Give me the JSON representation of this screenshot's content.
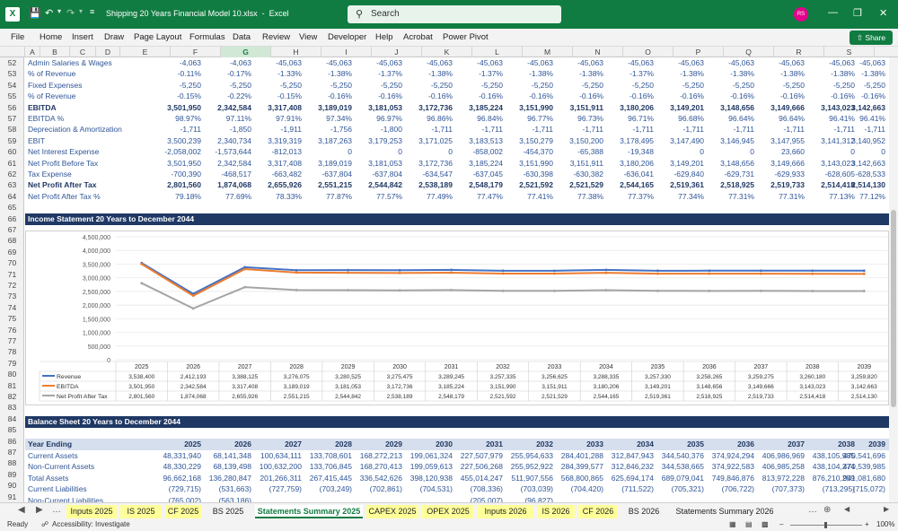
{
  "app": {
    "file_title": "Shipping 20 Years Financial Model 10.xlsx",
    "app_name": "Excel",
    "search_placeholder": "Search",
    "avatar_initials": "RS",
    "share_label": "Share"
  },
  "menu": [
    "File",
    "Home",
    "Insert",
    "Draw",
    "Page Layout",
    "Formulas",
    "Data",
    "Review",
    "View",
    "Developer",
    "Help",
    "Acrobat",
    "Power Pivot"
  ],
  "columns": [
    "A",
    "B",
    "C",
    "D",
    "E",
    "F",
    "G",
    "H",
    "I",
    "J",
    "K",
    "L",
    "M",
    "N",
    "O",
    "P",
    "Q",
    "R",
    "S"
  ],
  "selected_column": "G",
  "row_numbers": [
    "52",
    "53",
    "54",
    "55",
    "56",
    "57",
    "58",
    "59",
    "60",
    "61",
    "62",
    "63",
    "64",
    "65",
    "66",
    "67",
    "68",
    "69",
    "70",
    "71",
    "72",
    "73",
    "74",
    "75",
    "76",
    "77",
    "78",
    "79",
    "80",
    "81",
    "82",
    "83",
    "84",
    "85",
    "86",
    "87",
    "88",
    "89",
    "90",
    "91"
  ],
  "rows": [
    {
      "label": "Admin Salaries & Wages",
      "bold": false,
      "values": [
        "-4,063",
        "-4,063",
        "-45,063",
        "-45,063",
        "-45,063",
        "-45,063",
        "-45,063",
        "-45,063",
        "-45,063",
        "-45,063",
        "-45,063",
        "-45,063",
        "-45,063",
        "-45,063",
        "-45,063"
      ]
    },
    {
      "label": "% of Revenue",
      "bold": false,
      "values": [
        "-0.11%",
        "-0.17%",
        "-1.33%",
        "-1.38%",
        "-1.37%",
        "-1.38%",
        "-1.37%",
        "-1.38%",
        "-1.38%",
        "-1.37%",
        "-1.38%",
        "-1.38%",
        "-1.38%",
        "-1.38%",
        "-1.38%"
      ]
    },
    {
      "label": "Fixed Expenses",
      "bold": false,
      "values": [
        "-5,250",
        "-5,250",
        "-5,250",
        "-5,250",
        "-5,250",
        "-5,250",
        "-5,250",
        "-5,250",
        "-5,250",
        "-5,250",
        "-5,250",
        "-5,250",
        "-5,250",
        "-5,250",
        "-5,250"
      ]
    },
    {
      "label": "% of Revenue",
      "bold": false,
      "values": [
        "-0.15%",
        "-0.22%",
        "-0.15%",
        "-0.16%",
        "-0.16%",
        "-0.16%",
        "-0.16%",
        "-0.16%",
        "-0.16%",
        "-0.16%",
        "-0.16%",
        "-0.16%",
        "-0.16%",
        "-0.16%",
        "-0.16%"
      ]
    },
    {
      "label": "EBITDA",
      "bold": true,
      "values": [
        "3,501,950",
        "2,342,584",
        "3,317,408",
        "3,189,019",
        "3,181,053",
        "3,172,736",
        "3,185,224",
        "3,151,990",
        "3,151,911",
        "3,180,206",
        "3,149,201",
        "3,148,656",
        "3,149,666",
        "3,143,023",
        "3,142,663"
      ]
    },
    {
      "label": "EBITDA %",
      "bold": false,
      "values": [
        "98.97%",
        "97.11%",
        "97.91%",
        "97.34%",
        "96.97%",
        "96.86%",
        "96.84%",
        "96.77%",
        "96.73%",
        "96.71%",
        "96.68%",
        "96.64%",
        "96.64%",
        "96.41%",
        "96.41%"
      ]
    },
    {
      "label": "Depreciation & Amortization",
      "bold": false,
      "values": [
        "-1,711",
        "-1,850",
        "-1,911",
        "-1,756",
        "-1,800",
        "-1,711",
        "-1,711",
        "-1,711",
        "-1,711",
        "-1,711",
        "-1,711",
        "-1,711",
        "-1,711",
        "-1,711",
        "-1,711"
      ]
    },
    {
      "label": "EBIT",
      "bold": false,
      "values": [
        "3,500,239",
        "2,340,734",
        "3,319,319",
        "3,187,263",
        "3,179,253",
        "3,171,025",
        "3,183,513",
        "3,150,279",
        "3,150,200",
        "3,178,495",
        "3,147,490",
        "3,146,945",
        "3,147,955",
        "3,141,312",
        "3,140,952"
      ]
    },
    {
      "label": "Net Interest Expense",
      "bold": false,
      "values": [
        "-2,058,002",
        "-1,573,644",
        "-812,013",
        "0",
        "0",
        "0",
        "-858,002",
        "-454,370",
        "-65,388",
        "-19,348",
        "0",
        "0",
        "23,660",
        "0",
        "0"
      ]
    },
    {
      "label": "Net Profit Before Tax",
      "bold": false,
      "values": [
        "3,501,950",
        "2,342,584",
        "3,317,408",
        "3,189,019",
        "3,181,053",
        "3,172,736",
        "3,185,224",
        "3,151,990",
        "3,151,911",
        "3,180,206",
        "3,149,201",
        "3,148,656",
        "3,149,666",
        "3,143,023",
        "3,142,663"
      ]
    },
    {
      "label": "Tax Expense",
      "bold": false,
      "values": [
        "-700,390",
        "-468,517",
        "-663,482",
        "-637,804",
        "-637,804",
        "-634,547",
        "-637,045",
        "-630,398",
        "-630,382",
        "-636,041",
        "-629,840",
        "-629,731",
        "-629,933",
        "-628,605",
        "-628,533"
      ]
    },
    {
      "label": "Net Profit After Tax",
      "bold": true,
      "values": [
        "2,801,560",
        "1,874,068",
        "2,655,926",
        "2,551,215",
        "2,544,842",
        "2,538,189",
        "2,548,179",
        "2,521,592",
        "2,521,529",
        "2,544,165",
        "2,519,361",
        "2,518,925",
        "2,519,733",
        "2,514,418",
        "2,514,130"
      ]
    },
    {
      "label": "Net Profit After Tax %",
      "bold": false,
      "values": [
        "79.18%",
        "77.69%",
        "78.33%",
        "77.87%",
        "77.57%",
        "77.49%",
        "77.47%",
        "77.41%",
        "77.38%",
        "77.37%",
        "77.34%",
        "77.31%",
        "77.31%",
        "77.13%",
        "77.12%"
      ]
    }
  ],
  "income_banner": "Income Statement 20 Years to December 2044",
  "chart_data": {
    "type": "line",
    "title": "",
    "categories": [
      "2025",
      "2026",
      "2027",
      "2028",
      "2029",
      "2030",
      "2031",
      "2032",
      "2033",
      "2034",
      "2035",
      "2036",
      "2037",
      "2038",
      "2039"
    ],
    "y_ticks": [
      "4,500,000",
      "4,000,000",
      "3,500,000",
      "3,000,000",
      "2,500,000",
      "2,000,000",
      "1,500,000",
      "1,000,000",
      "500,000",
      "0"
    ],
    "ylim": [
      0,
      4500000
    ],
    "series": [
      {
        "name": "Revenue",
        "color": "#4472c4",
        "values": [
          3538400,
          2412193,
          3388125,
          3276075,
          3280525,
          3275475,
          3289245,
          3257335,
          3256625,
          3288335,
          3257330,
          3258265,
          3259275,
          3260180,
          3259820
        ],
        "labels": [
          "3,538,400",
          "2,412,193",
          "3,388,125",
          "3,276,075",
          "3,280,525",
          "3,275,475",
          "3,289,245",
          "3,257,335",
          "3,256,625",
          "3,288,335",
          "3,257,330",
          "3,258,265",
          "3,259,275",
          "3,260,180",
          "3,259,820"
        ]
      },
      {
        "name": "EBITDA",
        "color": "#ed7d31",
        "values": [
          3501950,
          2342584,
          3317408,
          3189019,
          3181053,
          3172736,
          3185224,
          3151990,
          3151911,
          3180206,
          3149201,
          3148656,
          3149666,
          3143023,
          3142663
        ],
        "labels": [
          "3,501,950",
          "2,342,584",
          "3,317,408",
          "3,189,019",
          "3,181,053",
          "3,172,736",
          "3,185,224",
          "3,151,990",
          "3,151,911",
          "3,180,206",
          "3,149,201",
          "3,148,656",
          "3,149,666",
          "3,143,023",
          "3,142,663"
        ]
      },
      {
        "name": "Net Profit After Tax",
        "color": "#a5a5a5",
        "values": [
          2801560,
          1874068,
          2655926,
          2551215,
          2544842,
          2538189,
          2548179,
          2521592,
          2521529,
          2544165,
          2519361,
          2518925,
          2519733,
          2514418,
          2514130
        ],
        "labels": [
          "2,801,560",
          "1,874,068",
          "2,655,926",
          "2,551,215",
          "2,544,842",
          "2,538,189",
          "2,548,179",
          "2,521,592",
          "2,521,529",
          "2,544,165",
          "2,519,361",
          "2,518,925",
          "2,519,733",
          "2,514,418",
          "2,514,130"
        ]
      }
    ]
  },
  "balance": {
    "banner": "Balance Sheet 20 Years to December 2044",
    "header_label": "Year Ending",
    "years": [
      "2025",
      "2026",
      "2027",
      "2028",
      "2029",
      "2030",
      "2031",
      "2032",
      "2033",
      "2034",
      "2035",
      "2036",
      "2037",
      "2038",
      "2039"
    ],
    "rows": [
      {
        "label": "Current Assets",
        "values": [
          "48,331,940",
          "68,141,348",
          "100,634,111",
          "133,708,601",
          "168,272,213",
          "199,061,324",
          "227,507,979",
          "255,954,633",
          "284,401,288",
          "312,847,943",
          "344,540,376",
          "374,924,294",
          "406,986,969",
          "438,105,985",
          "470,541,696"
        ]
      },
      {
        "label": "Non-Current Assets",
        "values": [
          "48,330,229",
          "68,139,498",
          "100,632,200",
          "133,706,845",
          "168,270,413",
          "199,059,613",
          "227,506,268",
          "255,952,922",
          "284,399,577",
          "312,846,232",
          "344,538,665",
          "374,922,583",
          "406,985,258",
          "438,104,274",
          "470,539,985"
        ]
      },
      {
        "label": "Total Assets",
        "values": [
          "96,662,168",
          "136,280,847",
          "201,266,311",
          "267,415,445",
          "336,542,626",
          "398,120,938",
          "455,014,247",
          "511,907,556",
          "568,800,865",
          "625,694,174",
          "689,079,041",
          "749,846,876",
          "813,972,228",
          "876,210,259",
          "941,081,680"
        ]
      },
      {
        "label": "Current Liabilities",
        "values": [
          "(729,715)",
          "(531,663)",
          "(727,759)",
          "(703,249)",
          "(702,861)",
          "(704,531)",
          "(708,336)",
          "(703,039)",
          "(704,420)",
          "(711,522)",
          "(705,321)",
          "(706,722)",
          "(707,373)",
          "(713,295)",
          "(715,072)"
        ]
      },
      {
        "label": "Non-Current Liabilities",
        "values": [
          "(765,002)",
          "(563,186)",
          "",
          "",
          "",
          "",
          "(205,007)",
          "(96,827)",
          "",
          "",
          "",
          "",
          "",
          "",
          ""
        ]
      }
    ]
  },
  "tabs": [
    {
      "label": "Inputs 2025",
      "style": "y"
    },
    {
      "label": "IS 2025",
      "style": "y"
    },
    {
      "label": "CF 2025",
      "style": "y"
    },
    {
      "label": "BS 2025",
      "style": "n"
    },
    {
      "label": "Statements Summary 2025",
      "style": "act"
    },
    {
      "label": "CAPEX 2025",
      "style": "y"
    },
    {
      "label": "OPEX 2025",
      "style": "y"
    },
    {
      "label": "Inputs 2026",
      "style": "y"
    },
    {
      "label": "IS 2026",
      "style": "y"
    },
    {
      "label": "CF 2026",
      "style": "y"
    },
    {
      "label": "BS 2026",
      "style": "n"
    },
    {
      "label": "Statements Summary 2026",
      "style": "n"
    }
  ],
  "status": {
    "ready": "Ready",
    "accessibility": "Accessibility: Investigate",
    "zoom": "100%"
  }
}
